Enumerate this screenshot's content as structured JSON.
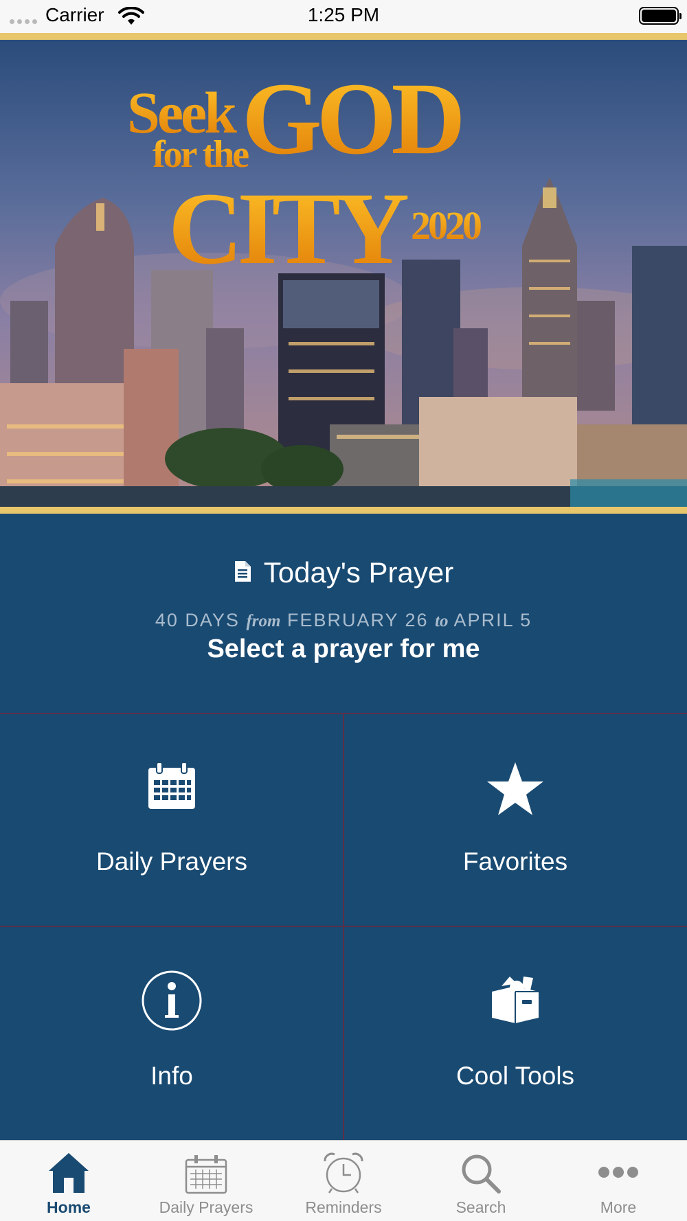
{
  "status_bar": {
    "carrier": "Carrier",
    "time": "1:25 PM"
  },
  "hero": {
    "title_seek": "Seek",
    "title_god": "GOD",
    "title_for_the": "for the",
    "title_city": "CITY",
    "title_year": "2020"
  },
  "today": {
    "icon": "document-icon",
    "title": "Today's Prayer",
    "dates": {
      "days": "40 DAYS",
      "from": "from",
      "start": "FEBRUARY 26",
      "to": "to",
      "end": "APRIL 5"
    },
    "select_label": "Select a prayer for me"
  },
  "tiles": [
    {
      "label": "Daily Prayers",
      "icon": "calendar-icon"
    },
    {
      "label": "Favorites",
      "icon": "star-icon"
    },
    {
      "label": "Info",
      "icon": "info-icon"
    },
    {
      "label": "Cool Tools",
      "icon": "toolbox-icon"
    }
  ],
  "tab_bar": {
    "tabs": [
      {
        "label": "Home",
        "icon": "home-icon",
        "active": true
      },
      {
        "label": "Daily Prayers",
        "icon": "calendar-icon",
        "active": false
      },
      {
        "label": "Reminders",
        "icon": "alarm-clock-icon",
        "active": false
      },
      {
        "label": "Search",
        "icon": "search-icon",
        "active": false
      },
      {
        "label": "More",
        "icon": "more-icon",
        "active": false
      }
    ]
  },
  "colors": {
    "primary": "#194a72",
    "gold": "#e8c76c",
    "title_gold": "#f2a516",
    "divider": "#5a2f48",
    "tab_inactive": "#8e8e8e",
    "status_bar_bg": "#f7f7f7"
  }
}
